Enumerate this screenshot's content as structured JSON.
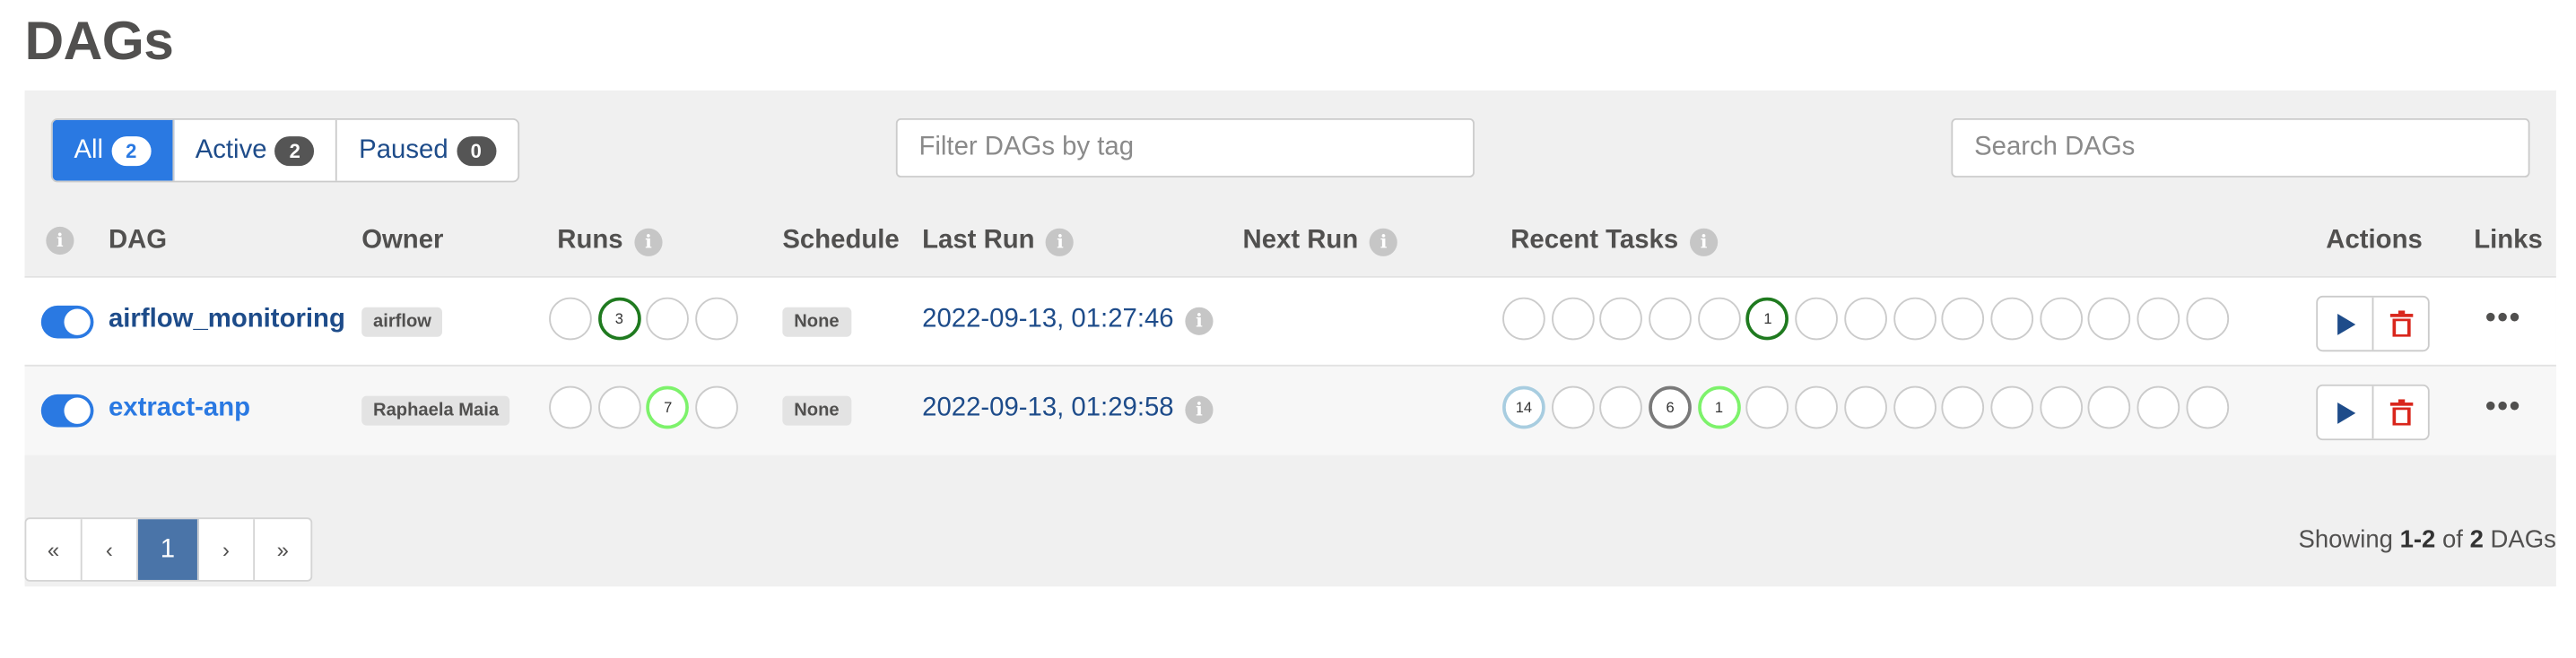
{
  "page": {
    "title": "DAGs"
  },
  "filters": {
    "status_tabs": [
      {
        "label": "All",
        "count": "2",
        "active": true
      },
      {
        "label": "Active",
        "count": "2",
        "active": false
      },
      {
        "label": "Paused",
        "count": "0",
        "active": false
      }
    ],
    "tag_placeholder": "Filter DAGs by tag",
    "search_placeholder": "Search DAGs"
  },
  "table": {
    "headers": {
      "dag": "DAG",
      "owner": "Owner",
      "runs": "Runs",
      "schedule": "Schedule",
      "last_run": "Last Run",
      "next_run": "Next Run",
      "recent_tasks": "Recent Tasks",
      "actions": "Actions",
      "links": "Links"
    },
    "rows": [
      {
        "dag_id": "airflow_monitoring",
        "owner": "airflow",
        "schedule": "None",
        "last_run": "2022-09-13, 01:27:46",
        "runs": [
          {
            "count": "",
            "color": "#cbcbcb"
          },
          {
            "count": "3",
            "color": "#1f7a1f"
          },
          {
            "count": "",
            "color": "#cbcbcb"
          },
          {
            "count": "",
            "color": "#cbcbcb"
          }
        ],
        "tasks": [
          {
            "count": "",
            "color": "#cbcbcb"
          },
          {
            "count": "",
            "color": "#cbcbcb"
          },
          {
            "count": "",
            "color": "#cbcbcb"
          },
          {
            "count": "",
            "color": "#cbcbcb"
          },
          {
            "count": "",
            "color": "#cbcbcb"
          },
          {
            "count": "1",
            "color": "#1f7a1f"
          },
          {
            "count": "",
            "color": "#cbcbcb"
          },
          {
            "count": "",
            "color": "#cbcbcb"
          },
          {
            "count": "",
            "color": "#cbcbcb"
          },
          {
            "count": "",
            "color": "#cbcbcb"
          },
          {
            "count": "",
            "color": "#cbcbcb"
          },
          {
            "count": "",
            "color": "#cbcbcb"
          },
          {
            "count": "",
            "color": "#cbcbcb"
          },
          {
            "count": "",
            "color": "#cbcbcb"
          },
          {
            "count": "",
            "color": "#cbcbcb"
          }
        ]
      },
      {
        "dag_id": "extract-anp",
        "owner": "Raphaela Maia",
        "schedule": "None",
        "last_run": "2022-09-13, 01:29:58",
        "runs": [
          {
            "count": "",
            "color": "#cbcbcb"
          },
          {
            "count": "",
            "color": "#cbcbcb"
          },
          {
            "count": "7",
            "color": "#7df26b"
          },
          {
            "count": "",
            "color": "#cbcbcb"
          }
        ],
        "tasks": [
          {
            "count": "14",
            "color": "#a8cde0"
          },
          {
            "count": "",
            "color": "#cbcbcb"
          },
          {
            "count": "",
            "color": "#cbcbcb"
          },
          {
            "count": "6",
            "color": "#7a7a7a"
          },
          {
            "count": "1",
            "color": "#7df26b"
          },
          {
            "count": "",
            "color": "#cbcbcb"
          },
          {
            "count": "",
            "color": "#cbcbcb"
          },
          {
            "count": "",
            "color": "#cbcbcb"
          },
          {
            "count": "",
            "color": "#cbcbcb"
          },
          {
            "count": "",
            "color": "#cbcbcb"
          },
          {
            "count": "",
            "color": "#cbcbcb"
          },
          {
            "count": "",
            "color": "#cbcbcb"
          },
          {
            "count": "",
            "color": "#cbcbcb"
          },
          {
            "count": "",
            "color": "#cbcbcb"
          },
          {
            "count": "",
            "color": "#cbcbcb"
          }
        ]
      }
    ]
  },
  "pagination": {
    "first": "«",
    "prev": "‹",
    "current": "1",
    "next": "›",
    "last": "»"
  },
  "footer": {
    "showing_prefix": "Showing ",
    "range": "1-2",
    "of": " of ",
    "total": "2",
    "suffix": " DAGs"
  },
  "icons": {
    "info": "info-icon",
    "trigger": "play-icon",
    "delete": "trash-icon",
    "links": "more-dots-icon"
  },
  "colors": {
    "primary": "#2a79e2",
    "link": "#1e4c8a",
    "delete": "#d9261c",
    "page_active": "#4a74a8"
  }
}
